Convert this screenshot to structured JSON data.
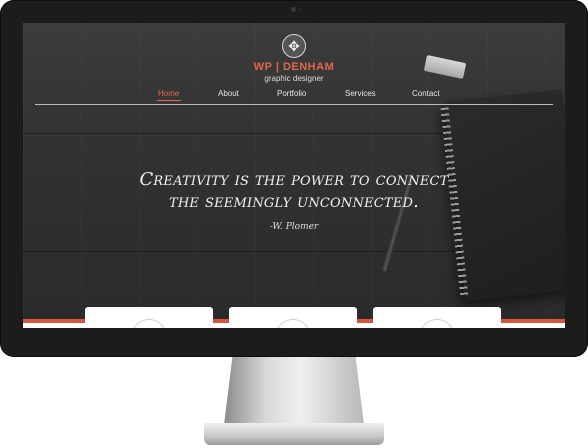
{
  "site": {
    "brand_name": "WP | DENHAM",
    "brand_subtitle": "graphic designer",
    "logo_glyph": "✥"
  },
  "nav": {
    "items": [
      {
        "label": "Home",
        "active": true
      },
      {
        "label": "About",
        "active": false
      },
      {
        "label": "Portfolio",
        "active": false
      },
      {
        "label": "Services",
        "active": false
      },
      {
        "label": "Contact",
        "active": false
      }
    ]
  },
  "hero": {
    "quote_line1": "Creativity is the power to connect",
    "quote_line2": "the seemingly unconnected.",
    "author": "-W. Plomer"
  },
  "device": {
    "apple_glyph": ""
  },
  "colors": {
    "accent": "#e0674b",
    "band": "#d9553b",
    "screen_bg": "#333333",
    "monitor_bezel": "#1c1c1c"
  }
}
